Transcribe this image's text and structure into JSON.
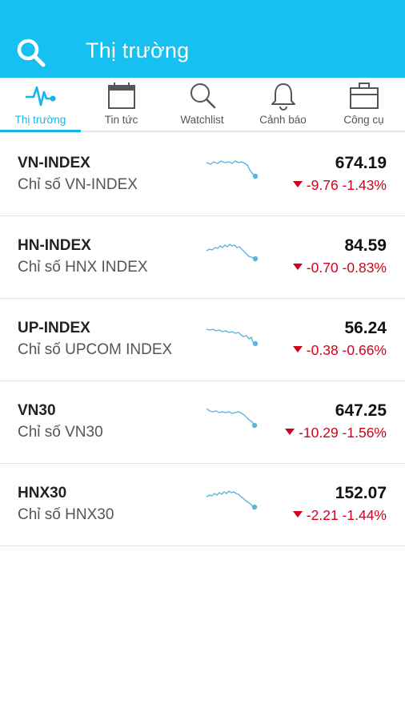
{
  "header": {
    "title": "Thị trường",
    "search_icon": "search-icon",
    "background_color": "#16c0f0"
  },
  "tabs": [
    {
      "label": "Thị trường",
      "icon": "pulse-icon",
      "active": true
    },
    {
      "label": "Tin tức",
      "icon": "calendar-icon",
      "active": false
    },
    {
      "label": "Watchlist",
      "icon": "magnifier-icon",
      "active": false
    },
    {
      "label": "Cảnh báo",
      "icon": "bell-icon",
      "active": false
    },
    {
      "label": "Công cụ",
      "icon": "briefcase-icon",
      "active": false
    }
  ],
  "accent_color": "#16b4e8",
  "down_color": "#d0021b",
  "indices": [
    {
      "symbol": "VN-INDEX",
      "name": "Chỉ số VN-INDEX",
      "value": "674.19",
      "change": "-9.76 -1.43%",
      "direction": "down"
    },
    {
      "symbol": "HN-INDEX",
      "name": "Chỉ số HNX INDEX",
      "value": "84.59",
      "change": "-0.70 -0.83%",
      "direction": "down"
    },
    {
      "symbol": "UP-INDEX",
      "name": "Chỉ số UPCOM INDEX",
      "value": "56.24",
      "change": "-0.38 -0.66%",
      "direction": "down"
    },
    {
      "symbol": "VN30",
      "name": "Chỉ số VN30",
      "value": "647.25",
      "change": "-10.29 -1.56%",
      "direction": "down"
    },
    {
      "symbol": "HNX30",
      "name": "Chỉ số HNX30",
      "value": "152.07",
      "change": "-2.21 -1.44%",
      "direction": "down"
    }
  ]
}
